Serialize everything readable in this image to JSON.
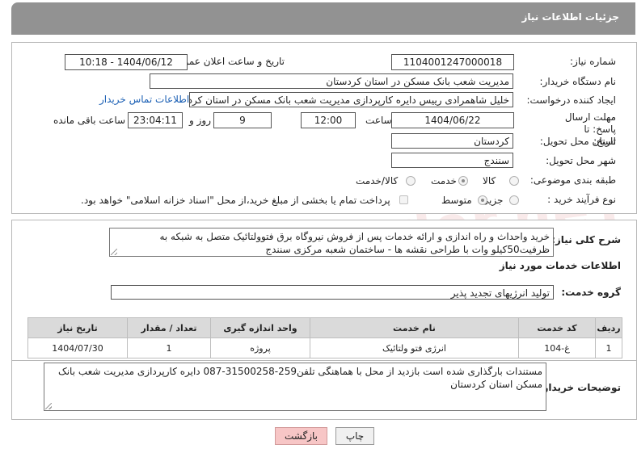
{
  "header": {
    "title": "جزئیات اطلاعات نیاز"
  },
  "form": {
    "need_number": {
      "label": "شماره نیاز:",
      "value": "1104001247000018"
    },
    "announce_datetime": {
      "label": "تاریخ و ساعت اعلان عمومی:",
      "value": "1404/06/12 - 10:18"
    },
    "buyer_org": {
      "label": "نام دستگاه خریدار:",
      "value": "مدیریت شعب بانک مسکن در استان کردستان"
    },
    "requester": {
      "label": "ایجاد کننده درخواست:",
      "value": "خلیل شاهمرادی رییس دایره کارپردازی مدیریت شعب بانک مسکن در استان کرد",
      "contact_link": "اطلاعات تماس خریدار"
    },
    "deadline": {
      "label": "مهلت ارسال پاسخ: تا تاریخ:",
      "date": "1404/06/22",
      "time_label": "ساعت",
      "time": "12:00",
      "days": "9",
      "days_label": "روز و",
      "remaining": "23:04:11",
      "remaining_label": "ساعت باقی مانده"
    },
    "province": {
      "label": "استان محل تحویل:",
      "value": "کردستان"
    },
    "city": {
      "label": "شهر محل تحویل:",
      "value": "سنندج"
    },
    "category": {
      "label": "طبقه بندی موضوعی:",
      "options": [
        "کالا",
        "خدمت",
        "کالا/خدمت"
      ],
      "selected": "خدمت"
    },
    "process": {
      "label": "نوع فرآیند خرید :",
      "options": [
        "جزیی",
        "متوسط"
      ],
      "selected": "متوسط",
      "note": "پرداخت تمام یا بخشی از مبلغ خرید،از محل \"اسناد خزانه اسلامی\" خواهد بود."
    }
  },
  "summary": {
    "label": "شرح کلی نیاز:",
    "text": "خرید واحداث و راه اندازی و ارائه خدمات پس از فروش نیروگاه برق فتوولتائیک متصل به شبکه به ظرفیت50کیلو وات با طراحی نقشه ها - ساختمان شعبه مرکزی سنندج"
  },
  "services": {
    "section_title": "اطلاعات خدمات مورد نیاز",
    "group_label": "گروه خدمت:",
    "group_value": "تولید انرژیهای تجدید پذیر",
    "table": {
      "headers": [
        "ردیف",
        "کد خدمت",
        "نام خدمت",
        "واحد اندازه گیری",
        "تعداد / مقدار",
        "تاریخ نیاز"
      ],
      "rows": [
        [
          "1",
          "غ-104",
          "انرژی فتو ولتائیک",
          "پروژه",
          "1",
          "1404/07/30"
        ]
      ]
    }
  },
  "buyer_notes": {
    "label": "توضیحات خریدار:",
    "text": "مستندات بارگذاری شده است بازدید از محل با هماهنگی تلفن259-31500258-087 دایره کارپردازی مدیریت شعب بانک مسکن استان کردستان"
  },
  "buttons": {
    "print": "چاپ",
    "back": "بازگشت"
  },
  "watermark": "AriaTender.neT"
}
